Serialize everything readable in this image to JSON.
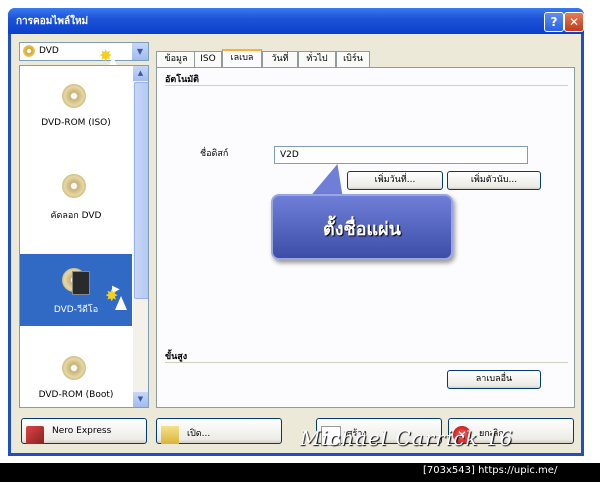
{
  "window": {
    "title": "การคอมไพล์ใหม่",
    "help_label": "?",
    "close_label": "✕"
  },
  "sidebar": {
    "combo_value": "DVD",
    "items": [
      {
        "label": "DVD-ROM (ISO)",
        "icon": "dvd-disc-icon"
      },
      {
        "label": "คัดลอก DVD",
        "icon": "dvd-disc-icon"
      },
      {
        "label": "DVD-วีดีโอ",
        "icon": "dvd-video-icon",
        "selected": true
      },
      {
        "label": "DVD-ROM (Boot)",
        "icon": "dvd-disc-icon"
      }
    ]
  },
  "tabs": [
    "ข้อมูล",
    "ISO",
    "เลเบล",
    "วันที่",
    "ทั่วไป",
    "เบิร์น"
  ],
  "active_tab": "เลเบล",
  "panel": {
    "auto_section": "อัตโนมัติ",
    "disc_name_label": "ชื่อดิสก์",
    "disc_name_value": "V2D",
    "add_date_button": "เพิ่มวันที่...",
    "add_counter_button": "เพิ่มตัวนับ...",
    "advanced_section": "ขั้นสูง",
    "other_labels_button": "ลาเบลอื่น"
  },
  "callout": {
    "text": "ตั้งชื่อแผ่น"
  },
  "bottom_buttons": {
    "nero_express": "Nero Express",
    "open": "เปิด...",
    "create": "สร้าง",
    "cancel": "ยกเลิก"
  },
  "watermark": "Michael Carrick 16",
  "footer": "[703x543] https://upic.me/"
}
